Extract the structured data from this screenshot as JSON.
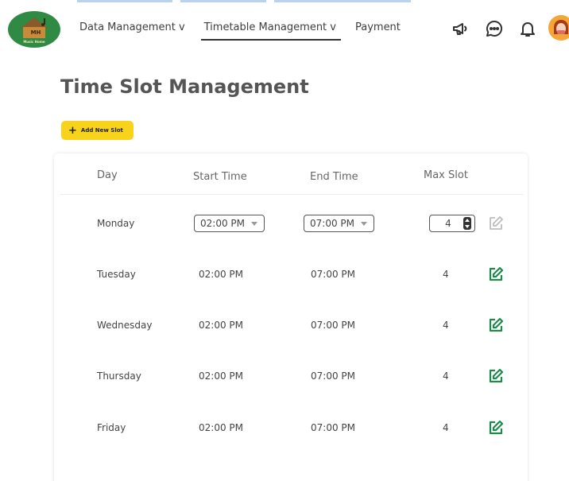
{
  "nav": {
    "items": [
      {
        "label": "Data Management v"
      },
      {
        "label": "Timetable Management v"
      },
      {
        "label": "Payment"
      }
    ]
  },
  "logo": {
    "initials": "MH",
    "subtitle": "Music Home"
  },
  "header_icons": [
    "megaphone-icon",
    "chat-icon",
    "bell-icon"
  ],
  "page": {
    "title": "Time Slot Management",
    "add_button_label": "Add New Slot"
  },
  "table": {
    "headers": {
      "day": "Day",
      "start": "Start Time",
      "end": "End Time",
      "max": "Max Slot"
    },
    "editing_row": {
      "day": "Monday",
      "start": "02:00 PM",
      "end": "07:00 PM",
      "max": "4"
    },
    "rows": [
      {
        "day": "Tuesday",
        "start": "02:00 PM",
        "end": "07:00 PM",
        "max": "4"
      },
      {
        "day": "Wednesday",
        "start": "02:00 PM",
        "end": "07:00 PM",
        "max": "4"
      },
      {
        "day": "Thursday",
        "start": "02:00 PM",
        "end": "07:00 PM",
        "max": "4"
      },
      {
        "day": "Friday",
        "start": "02:00 PM",
        "end": "07:00 PM",
        "max": "4"
      }
    ]
  },
  "colors": {
    "accent": "#f7d31b",
    "edit_active": "#1f8a4c",
    "edit_disabled": "#bdbdbd",
    "logo_green": "#2f8a43"
  }
}
